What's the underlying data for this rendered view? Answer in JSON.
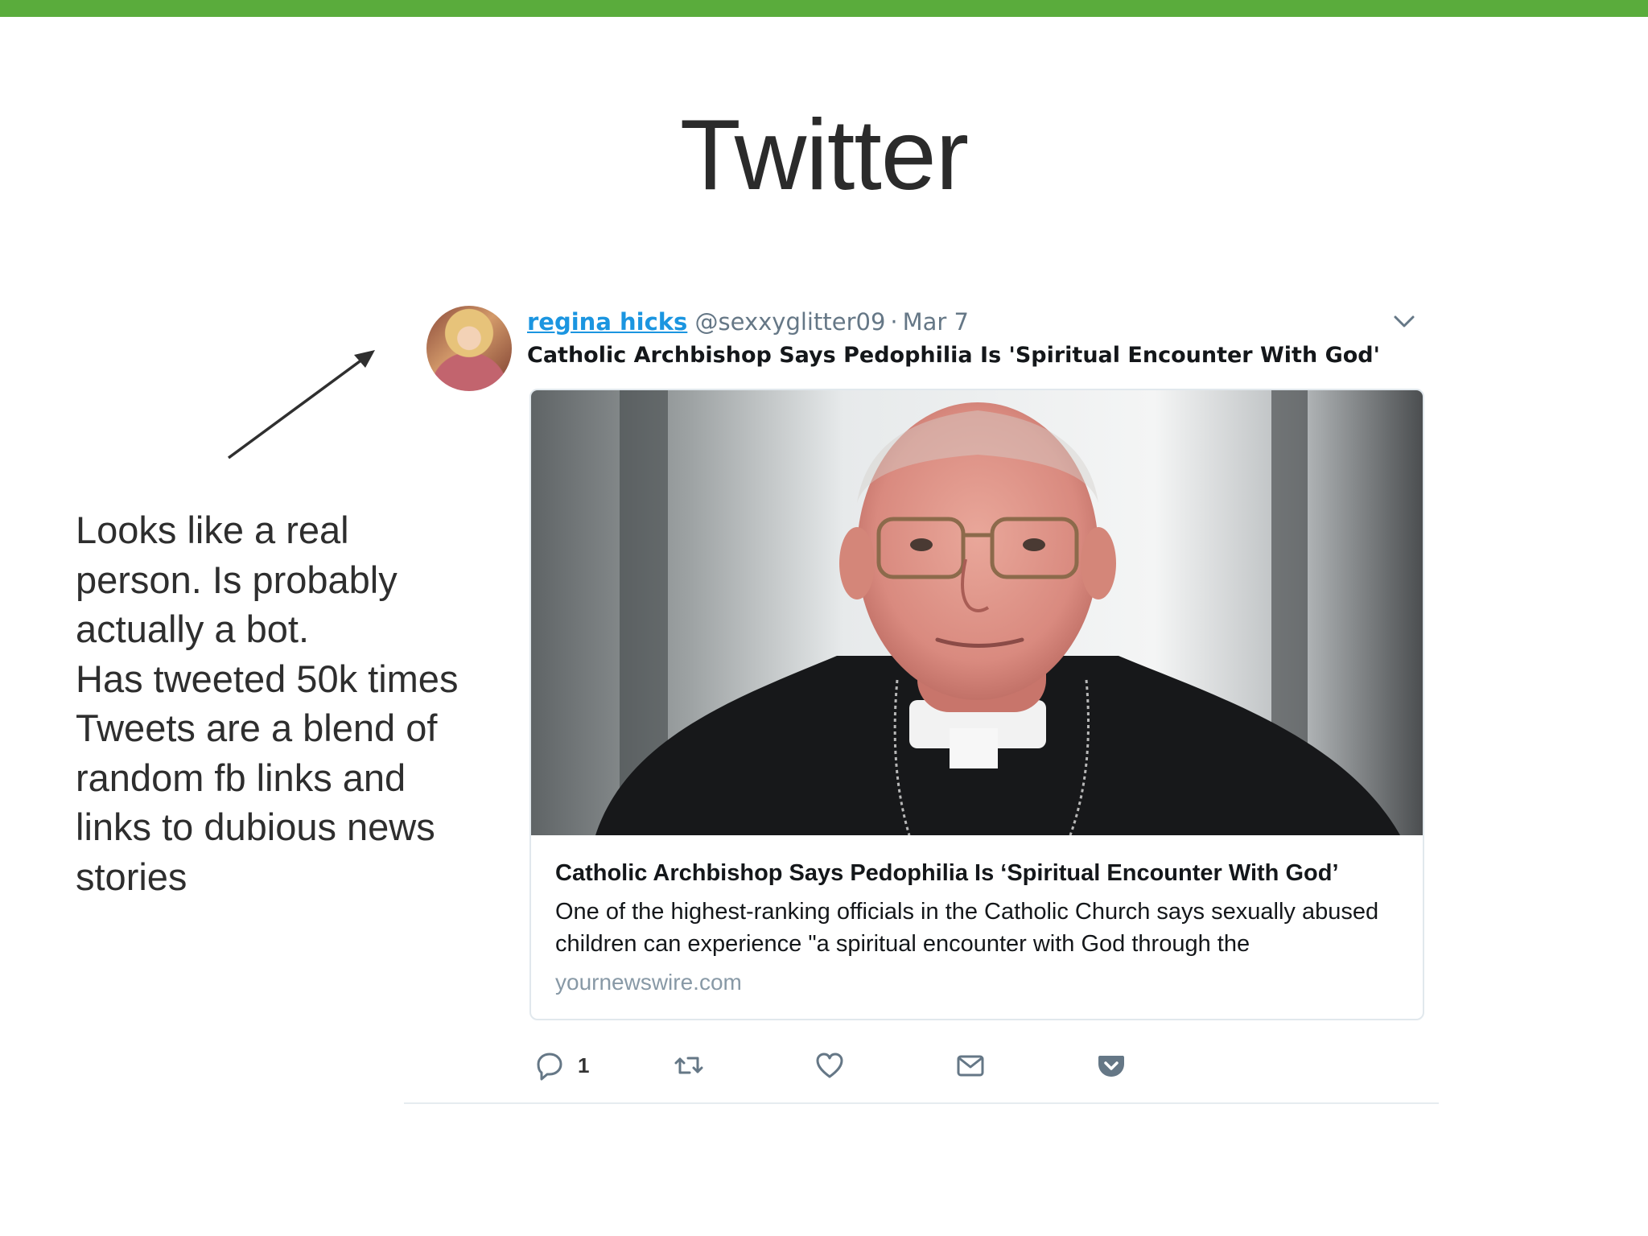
{
  "slide": {
    "title": "Twitter",
    "accent_color": "#5aac3c",
    "annotation_lines": [
      "Looks like a real",
      "person. Is probably",
      "actually a bot.",
      "Has tweeted 50k times",
      "Tweets are a blend of",
      "random fb links and",
      "links to dubious news",
      "stories"
    ]
  },
  "tweet": {
    "user_name": "regina hicks",
    "handle": "@sexxyglitter09",
    "separator": "·",
    "date": "Mar 7",
    "text": "Catholic Archbishop Says Pedophilia Is 'Spiritual Encounter With God'",
    "menu_icon": "chevron-down-icon",
    "avatar_icon": "user-avatar",
    "card": {
      "image_icon": "archbishop-photo",
      "title": "Catholic Archbishop Says Pedophilia Is ‘Spiritual Encounter With God’",
      "description": "One of the highest-ranking officials in the Catholic Church says sexually abused children can experience \"a spiritual encounter with God through the",
      "domain": "yournewswire.com"
    },
    "actions": {
      "reply_icon": "reply-icon",
      "reply_count": "1",
      "retweet_icon": "retweet-icon",
      "like_icon": "heart-icon",
      "dm_icon": "envelope-icon",
      "pocket_icon": "pocket-icon"
    },
    "colors": {
      "link": "#1b95e0",
      "secondary_text": "#657786",
      "action_icon": "#657786",
      "pocket": "#657786"
    }
  }
}
